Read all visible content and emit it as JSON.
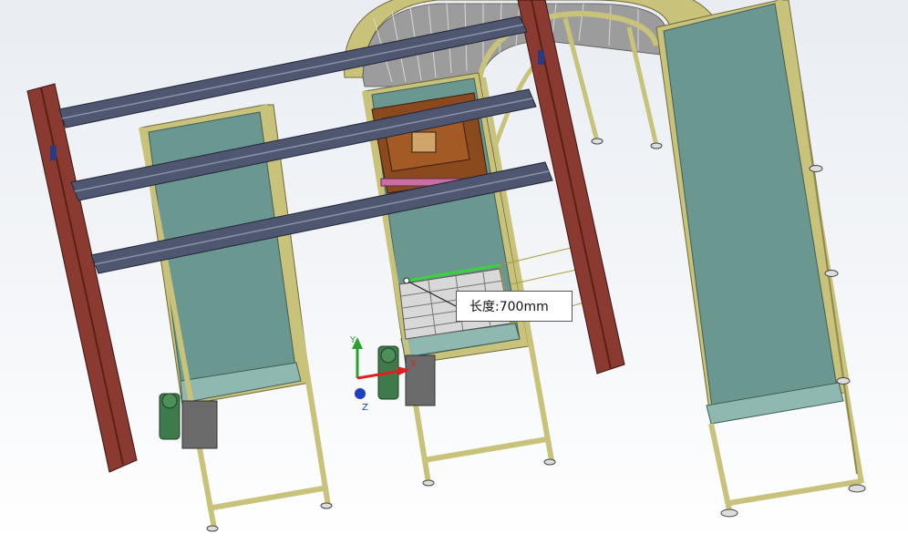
{
  "dimension": {
    "label": "长度:700mm"
  },
  "triad": {
    "y_label": "Y",
    "z_label": "Z",
    "x_label": "X"
  },
  "colors": {
    "background_top": "#e9edf2",
    "frame": "#c9c27a",
    "belt": "#6a9890",
    "beam": "#4f5670",
    "column": "#8a3a30",
    "plate": "#8b4a1e",
    "highlight": "#3ad43a"
  }
}
